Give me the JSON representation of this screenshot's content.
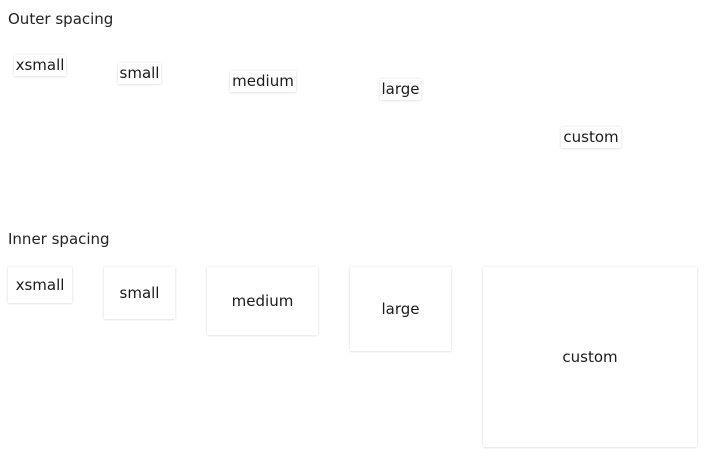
{
  "outer_section": {
    "heading": "Outer spacing",
    "items": [
      {
        "label": "xsmall"
      },
      {
        "label": "small"
      },
      {
        "label": "medium"
      },
      {
        "label": "large"
      },
      {
        "label": "custom"
      }
    ]
  },
  "inner_section": {
    "heading": "Inner spacing",
    "items": [
      {
        "label": "xsmall"
      },
      {
        "label": "small"
      },
      {
        "label": "medium"
      },
      {
        "label": "large"
      },
      {
        "label": "custom"
      }
    ]
  }
}
